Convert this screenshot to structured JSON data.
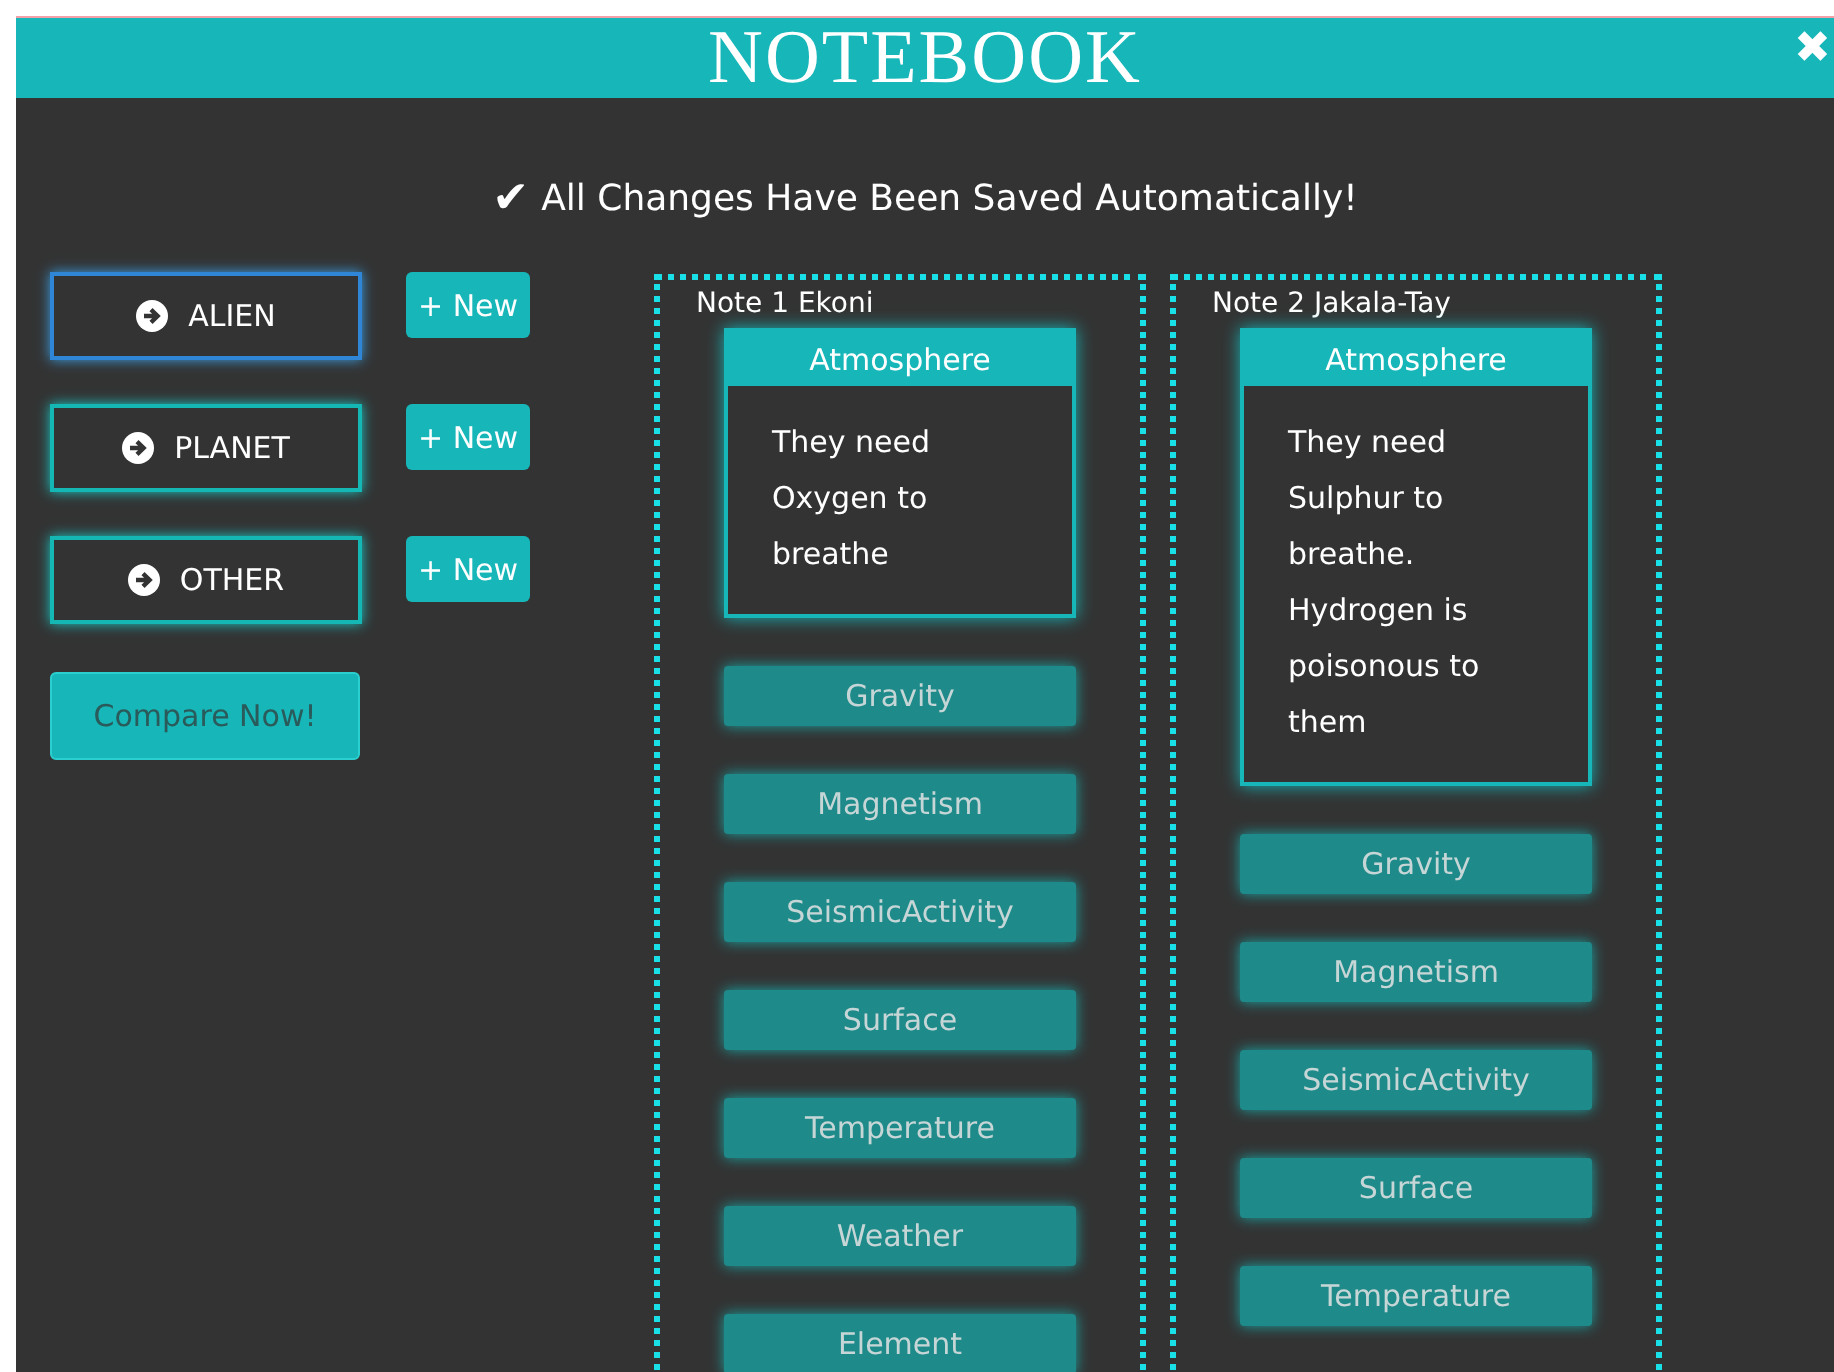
{
  "window": {
    "title": "NOTEBOOK",
    "close": "✖"
  },
  "status": {
    "check": "✔",
    "message": "All Changes Have Been Saved Automatically!"
  },
  "categories": [
    {
      "label": "ALIEN",
      "selected": true,
      "new_button": "+ New"
    },
    {
      "label": "PLANET",
      "selected": false,
      "new_button": "+ New"
    },
    {
      "label": "OTHER",
      "selected": false,
      "new_button": "+ New"
    }
  ],
  "compare_button": "Compare Now!",
  "notes": [
    {
      "title": "Note 1 Ekoni",
      "attributes": [
        {
          "label": "Atmosphere",
          "expanded": true,
          "text": "They need Oxygen to breathe"
        },
        {
          "label": "Gravity",
          "expanded": false
        },
        {
          "label": "Magnetism",
          "expanded": false
        },
        {
          "label": "SeismicActivity",
          "expanded": false
        },
        {
          "label": "Surface",
          "expanded": false
        },
        {
          "label": "Temperature",
          "expanded": false
        },
        {
          "label": "Weather",
          "expanded": false
        },
        {
          "label": "Element",
          "expanded": false
        }
      ]
    },
    {
      "title": "Note 2 Jakala-Tay",
      "attributes": [
        {
          "label": "Atmosphere",
          "expanded": true,
          "text": "They need Sulphur to breathe. Hydrogen is poisonous to them"
        },
        {
          "label": "Gravity",
          "expanded": false
        },
        {
          "label": "Magnetism",
          "expanded": false
        },
        {
          "label": "SeismicActivity",
          "expanded": false
        },
        {
          "label": "Surface",
          "expanded": false
        },
        {
          "label": "Temperature",
          "expanded": false
        }
      ]
    }
  ]
}
